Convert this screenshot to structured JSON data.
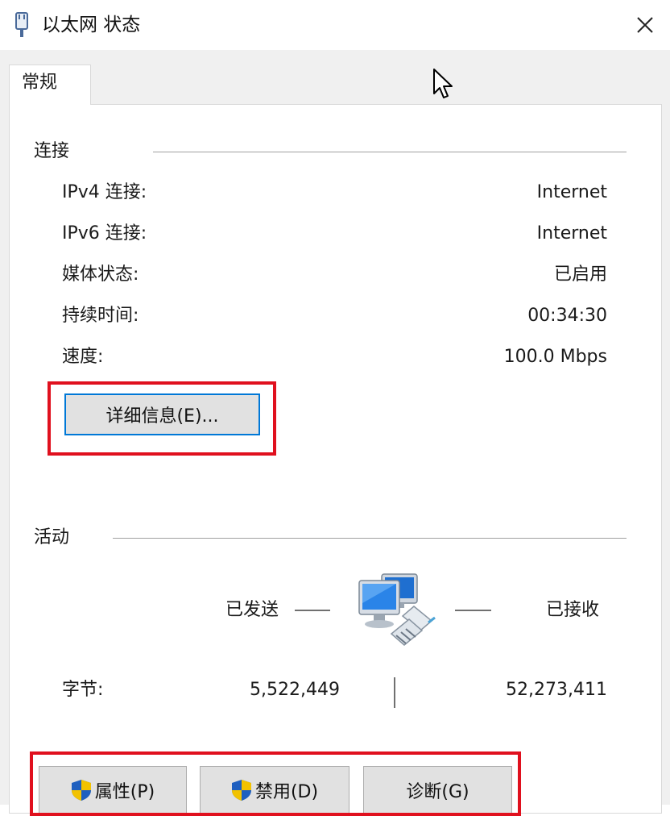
{
  "window": {
    "title": "以太网 状态",
    "icon": "ethernet-plug-icon",
    "close_icon": "close-icon"
  },
  "tabs": [
    {
      "label": "常规",
      "selected": true
    }
  ],
  "connection": {
    "group_label": "连接",
    "rows": [
      {
        "label": "IPv4 连接:",
        "value": "Internet"
      },
      {
        "label": "IPv6 连接:",
        "value": "Internet"
      },
      {
        "label": "媒体状态:",
        "value": "已启用"
      },
      {
        "label": "持续时间:",
        "value": "00:34:30"
      },
      {
        "label": "速度:",
        "value": "100.0 Mbps"
      }
    ],
    "details_button": "详细信息(E)..."
  },
  "activity": {
    "group_label": "活动",
    "sent_label": "已发送",
    "received_label": "已接收",
    "bytes_label": "字节:",
    "bytes_sent": "5,522,449",
    "bytes_received": "52,273,411",
    "icon": "network-computers-icon"
  },
  "buttons": {
    "properties": "属性(P)",
    "disable": "禁用(D)",
    "diagnose": "诊断(G)",
    "shield_icon": "uac-shield-icon"
  },
  "colors": {
    "highlight_box": "#e0101e",
    "default_button_border": "#0078d7"
  }
}
